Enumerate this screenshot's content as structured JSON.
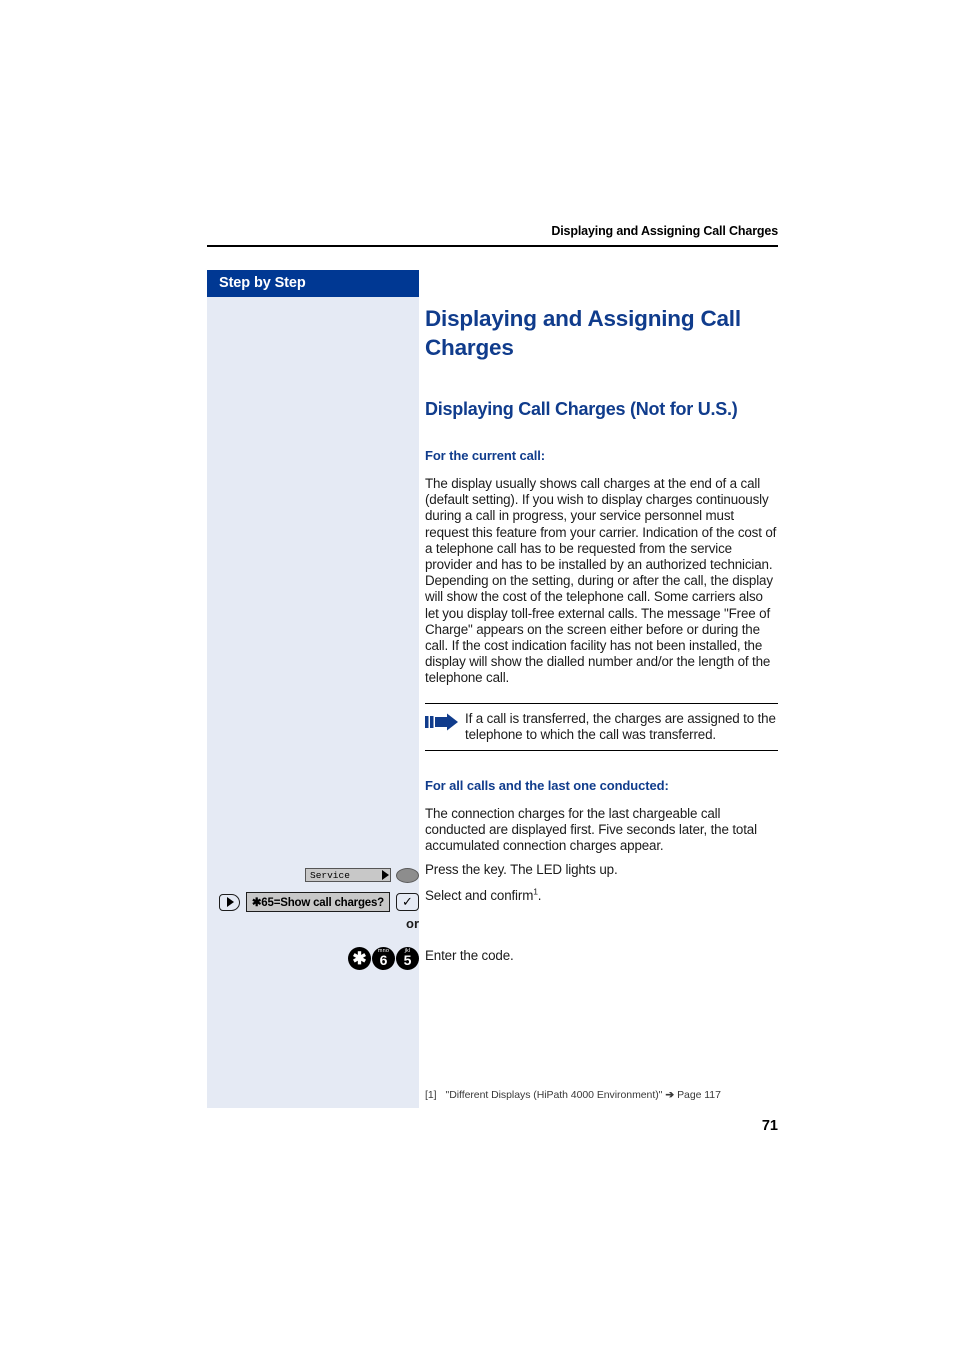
{
  "header": {
    "running_title": "Displaying and Assigning Call Charges"
  },
  "sidebar": {
    "title": "Step by Step"
  },
  "content": {
    "chapter_title": "Displaying and Assigning Call Charges",
    "section_title": "Displaying Call Charges (Not for U.S.)",
    "subheading_current": "For the current call:",
    "paragraph_current": "The display usually shows call charges at the end of a call (default setting). If you wish to display charges continuously during a call in progress, your service personnel must request this feature from your carrier. Indication of the cost of a telephone call has to be requested from the service provider and has to be installed by an authorized technician. Depending on the setting, during or after the call, the display will show the cost of the telephone call. Some carriers also let you display toll-free external calls. The message \"Free of Charge\" appears on the screen either before or during the call. If the cost indication facility has not been installed, the display will show the dialled number and/or the length of the telephone call.",
    "note_text": "If a call is transferred, the charges are assigned to the telephone to which the call was transferred.",
    "subheading_all_calls": "For all calls and the last one conducted:",
    "paragraph_all_calls": "The connection charges for the last chargeable call conducted are displayed first. Five seconds later, the total accumulated connection charges appear."
  },
  "steps": [
    {
      "key_label": "Service",
      "action": "Press the key. The LED lights up."
    },
    {
      "display_text": "✱65=Show call charges?",
      "action_prefix": "Select and confirm",
      "action_footnote_ref": "1",
      "action_suffix": "."
    },
    {
      "or_label": "or"
    },
    {
      "dialpad": [
        {
          "char": "✱",
          "letters": ""
        },
        {
          "char": "6",
          "letters": "mno"
        },
        {
          "char": "5",
          "letters": "jkl"
        }
      ],
      "action": "Enter the code."
    }
  ],
  "footnote": {
    "marker": "[1]",
    "text": "\"Different Displays (HiPath 4000 Environment)\"",
    "arrow": "➔",
    "target": "Page 117"
  },
  "folio": {
    "page_number": "71"
  },
  "colors": {
    "brand_blue": "#103c8c",
    "sidebar_head": "#003893",
    "sidebar_bg": "#e5eaf4",
    "key_grey": "#c8c8c8"
  }
}
